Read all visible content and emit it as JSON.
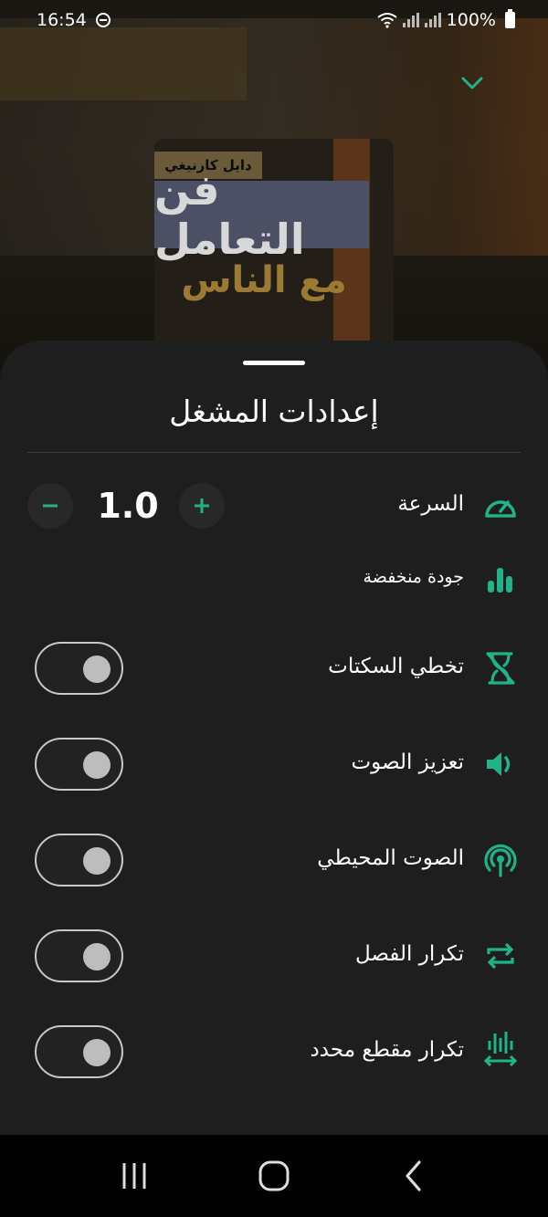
{
  "status": {
    "time": "16:54",
    "battery": "100%"
  },
  "cover": {
    "author": "دايل كارنيغي",
    "title": "فن التعامل",
    "subtitle": "مع الناس"
  },
  "sheet": {
    "title": "إعدادات المشغل"
  },
  "settings": {
    "speed": {
      "label": "السرعة",
      "value": "1.0",
      "icon": "speedometer-icon"
    },
    "quality": {
      "label": "جودة منخفضة",
      "icon": "bar-chart-icon"
    },
    "skip_silence": {
      "label": "تخطي السكتات",
      "icon": "hourglass-off-icon",
      "enabled": false
    },
    "volume_boost": {
      "label": "تعزيز الصوت",
      "icon": "volume-icon",
      "enabled": false
    },
    "ambient_sound": {
      "label": "الصوت المحيطي",
      "icon": "broadcast-icon",
      "enabled": false
    },
    "repeat_chapter": {
      "label": "تكرار الفصل",
      "icon": "repeat-icon",
      "enabled": false
    },
    "repeat_segment": {
      "label": "تكرار مقطع محدد",
      "icon": "segment-repeat-icon",
      "enabled": false
    }
  },
  "colors": {
    "accent": "#1fb387",
    "sheet_bg": "#1e1e1e"
  }
}
